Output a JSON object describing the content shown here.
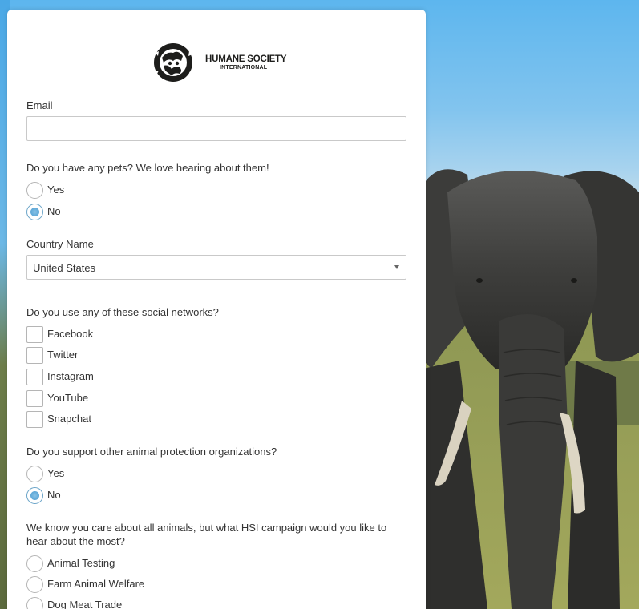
{
  "org": {
    "logo_name": "HUMANE SOCIETY",
    "logo_subname": "INTERNATIONAL"
  },
  "form": {
    "email": {
      "label": "Email",
      "value": ""
    },
    "pets": {
      "question": "Do you have any pets? We love hearing about them!",
      "options": [
        {
          "label": "Yes",
          "checked": false
        },
        {
          "label": "No",
          "checked": true
        }
      ]
    },
    "country": {
      "label": "Country Name",
      "selected": "United States"
    },
    "social": {
      "question": "Do you use any of these social networks?",
      "options": [
        "Facebook",
        "Twitter",
        "Instagram",
        "YouTube",
        "Snapchat"
      ]
    },
    "other_orgs": {
      "question": "Do you support other animal protection organizations?",
      "options": [
        {
          "label": "Yes",
          "checked": false
        },
        {
          "label": "No",
          "checked": true
        }
      ]
    },
    "campaign": {
      "question_line1": "We know you care about all animals, but what HSI campaign would you like to",
      "question_line2": "hear about the most?",
      "options": [
        "Animal Testing",
        "Farm Animal Welfare",
        "Dog Meat Trade"
      ]
    }
  },
  "colors": {
    "accent": "#4a9bd0",
    "border": "#c9c9c9",
    "text": "#333333",
    "card": "#ffffff"
  }
}
